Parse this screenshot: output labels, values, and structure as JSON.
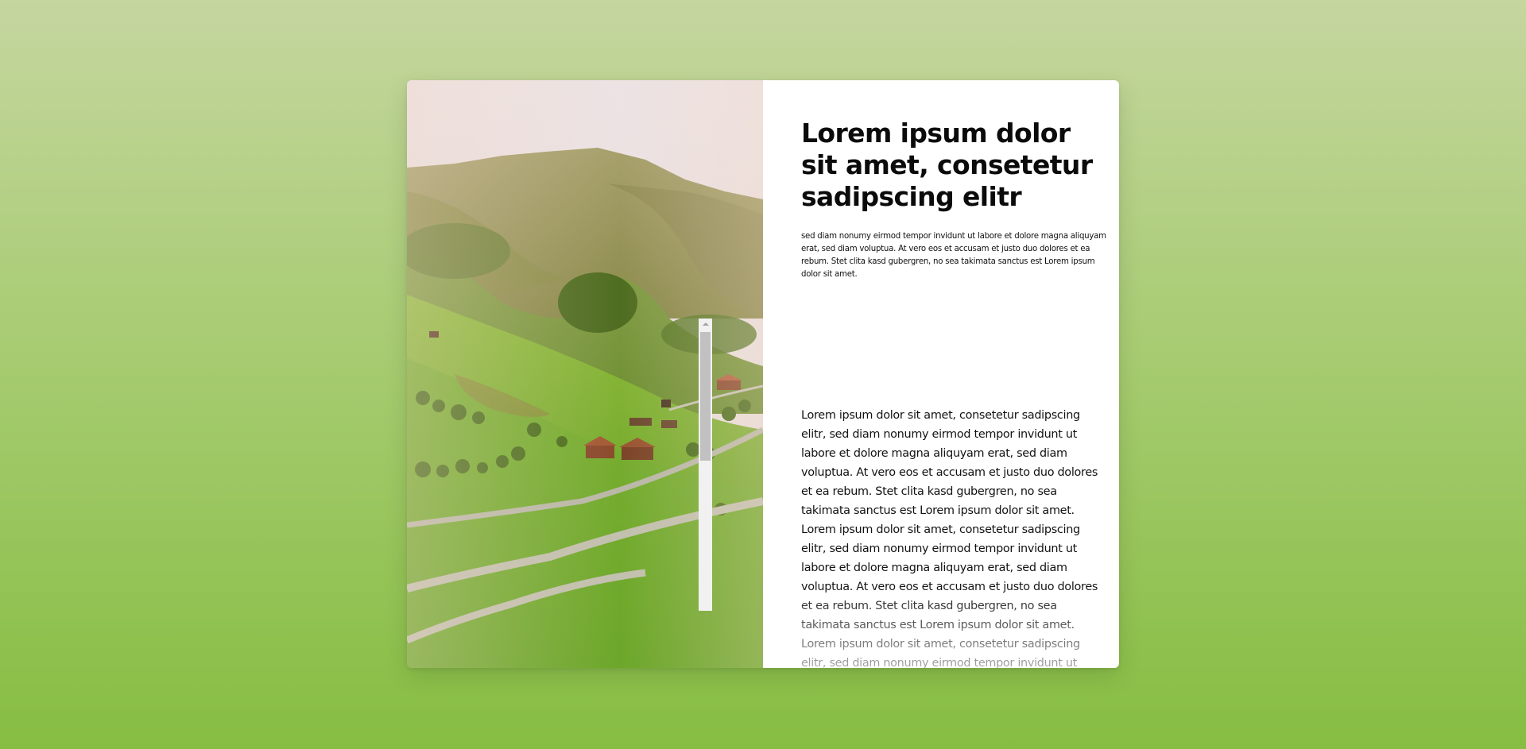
{
  "card": {
    "title": "Lorem ipsum dolor sit amet, consetetur sadipscing elitr",
    "subtitle": "sed diam nonumy eirmod tempor invidunt ut labore et dolore magna aliquyam erat, sed diam voluptua. At vero eos et accusam et justo duo dolores et ea rebum. Stet clita kasd gubergren, no sea takimata sanctus est Lorem ipsum dolor sit amet.",
    "body": "Lorem ipsum dolor sit amet, consetetur sadipscing elitr, sed diam nonumy eirmod tempor invidunt ut labore et dolore magna aliquyam erat, sed diam voluptua. At vero eos et accusam et justo duo dolores et ea rebum. Stet clita kasd gubergren, no sea takimata sanctus est Lorem ipsum dolor sit amet. Lorem ipsum dolor sit amet, consetetur sadipscing elitr, sed diam nonumy eirmod tempor invidunt ut labore et dolore magna aliquyam erat, sed diam voluptua. At vero eos et accusam et justo duo dolores et ea rebum. Stet clita kasd gubergren, no sea takimata sanctus est Lorem ipsum dolor sit amet. Lorem ipsum dolor sit amet, consetetur sadipscing elitr, sed diam nonumy eirmod tempor invidunt ut labore et dolore magna aliquyam erat, sed diam voluptua. At vero eos et accusam et justo duo dolores et ea rebum. Stet clita kasd gubergren, no sea takimata sanctus est Lorem ipsum dolor sit amet."
  },
  "image": {
    "subject": "green valley landscape with winding road and farmhouses"
  },
  "colors": {
    "background_top": "#c5d69f",
    "background_bottom": "#86bd42",
    "card_background": "#ffffff",
    "text": "#0b0b0b"
  }
}
